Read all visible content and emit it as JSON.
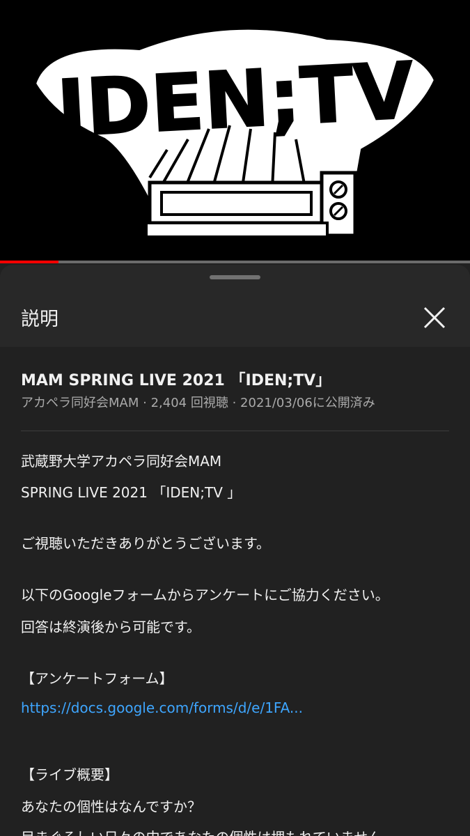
{
  "player": {
    "logo_text": "IDEN;TV",
    "progress_fraction": 0.125,
    "colors": {
      "progress": "#ff0000",
      "track": "#6b6b6b"
    }
  },
  "sheet": {
    "title": "説明",
    "close_icon": "close-x-icon"
  },
  "video": {
    "title": "MAM SPRING LIVE 2021 「IDEN;TV」",
    "channel": "アカペラ同好会MAM",
    "views": "2,404 回視聴",
    "date": "2021/03/06に公開済み",
    "separator": "·"
  },
  "description": {
    "line1": "武蔵野大学アカペラ同好会MAM",
    "line2": "SPRING LIVE 2021 「IDEN;TV 」",
    "line3": "ご視聴いただきありがとうございます。",
    "line4": "以下のGoogleフォームからアンケートにご協力ください。",
    "line5": "回答は終演後から可能です。",
    "line6": "【アンケートフォーム】",
    "link": "https://docs.google.com/forms/d/e/1FA...",
    "line7": "【ライブ概要】",
    "line8": "あなたの個性はなんですか？",
    "line9": "目まぐるしい日々の中であなたの個性は埋もれていません"
  }
}
